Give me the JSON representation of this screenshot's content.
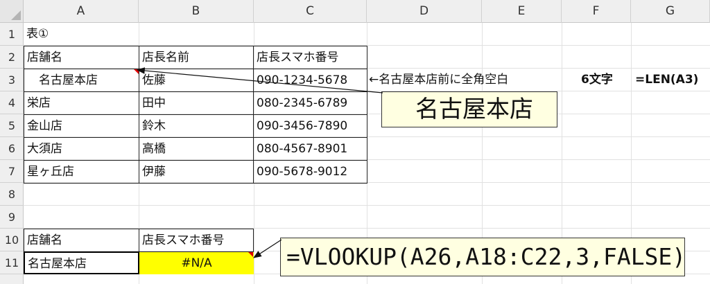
{
  "columns": [
    "A",
    "B",
    "C",
    "D",
    "E",
    "F",
    "G"
  ],
  "rows": [
    "1",
    "2",
    "3",
    "4",
    "5",
    "6",
    "7",
    "8",
    "9",
    "10",
    "11"
  ],
  "table1": {
    "title": "表①",
    "headers": [
      "店舗名",
      "店長名前",
      "店長スマホ番号"
    ],
    "data": [
      [
        "　名古屋本店",
        "佐藤",
        "090-1234-5678"
      ],
      [
        "栄店",
        "田中",
        "080-2345-6789"
      ],
      [
        "金山店",
        "鈴木",
        "090-3456-7890"
      ],
      [
        "大須店",
        "高橋",
        "080-4567-8901"
      ],
      [
        "星ヶ丘店",
        "伊藤",
        "090-5678-9012"
      ]
    ]
  },
  "notes": {
    "d3": "←名古屋本店前に全角空白",
    "f3": "6文字",
    "g3": "=LEN(A3)"
  },
  "callouts": {
    "store": "名古屋本店",
    "formula": "=VLOOKUP(A26,A18:C22,3,FALSE)"
  },
  "table2": {
    "headers": [
      "店舗名",
      "店長スマホ番号"
    ],
    "row": [
      "名古屋本店",
      "#N/A"
    ]
  },
  "colors": {
    "error_fill": "#ffff00",
    "comment_marker": "#e00000",
    "callout_fill": "#ffffe1"
  }
}
